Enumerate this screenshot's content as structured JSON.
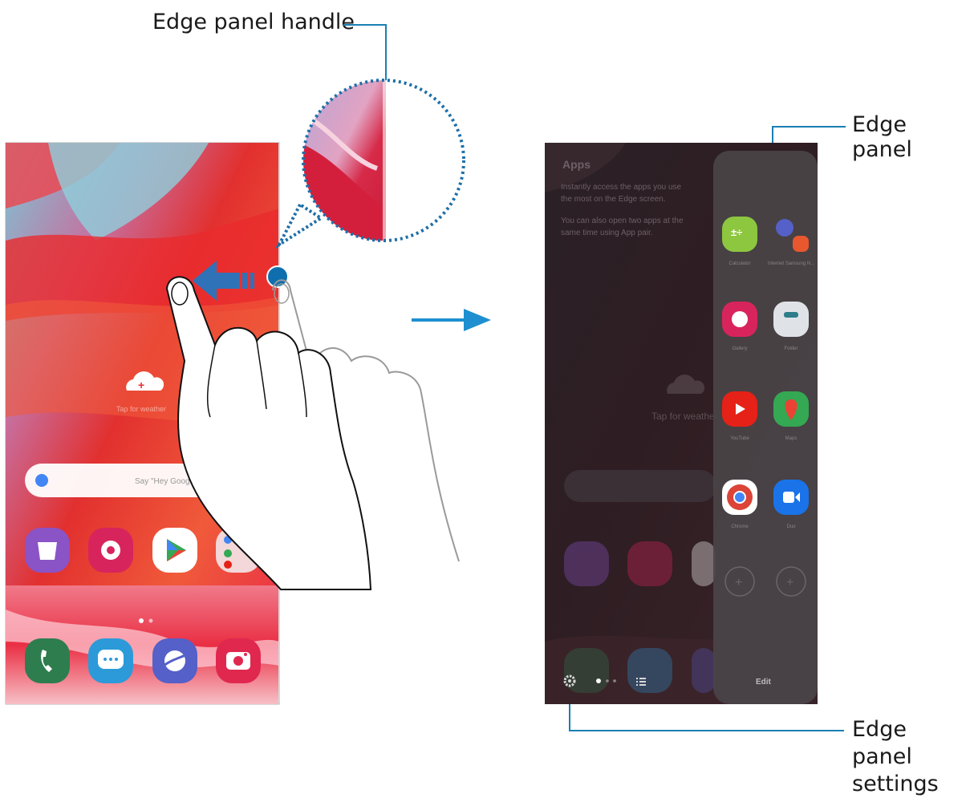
{
  "callouts": {
    "handle": "Edge panel handle",
    "panel": "Edge panel",
    "settings_line1": "Edge panel",
    "settings_line2": "settings"
  },
  "home_screen": {
    "weather_hint": "Tap for weather",
    "search_placeholder": "Say \"Hey Google\"",
    "page_dots": 2,
    "apps_row": [
      "galaxy-store-icon",
      "gallery-icon",
      "play-store-icon",
      "google-folder-icon"
    ],
    "dock": [
      "phone-icon",
      "messages-icon",
      "internet-icon",
      "camera-icon"
    ]
  },
  "edge_screen": {
    "intro_title": "Apps",
    "intro_text": "Instantly access the apps you use the most on the Edge screen.",
    "intro_text2": "You can also open two apps at the same time using App pair.",
    "weather_hint": "Tap for weather",
    "panel_apps": [
      {
        "label": "Calculator",
        "icon": "calculator-icon",
        "color": "#8dc63f"
      },
      {
        "label": "Internet Samsung N...",
        "icon": "internet-notes-pair-icon",
        "color": "#5560c8"
      },
      {
        "label": "Gallery",
        "icon": "gallery-icon",
        "color": "#d8245c"
      },
      {
        "label": "Folder",
        "icon": "folder-icon",
        "color": "#dfe3e8"
      },
      {
        "label": "YouTube",
        "icon": "youtube-icon",
        "color": "#e62117"
      },
      {
        "label": "Maps",
        "icon": "maps-icon",
        "color": "#34a853"
      },
      {
        "label": "Chrome",
        "icon": "chrome-icon",
        "color": "#ffffff"
      },
      {
        "label": "Duo",
        "icon": "duo-icon",
        "color": "#1a73e8"
      }
    ],
    "edit_label": "Edit"
  },
  "colors": {
    "accent_line": "#1a7fb3",
    "arrow": "#1e8fd0",
    "handle_dot": "#0f6fae"
  }
}
